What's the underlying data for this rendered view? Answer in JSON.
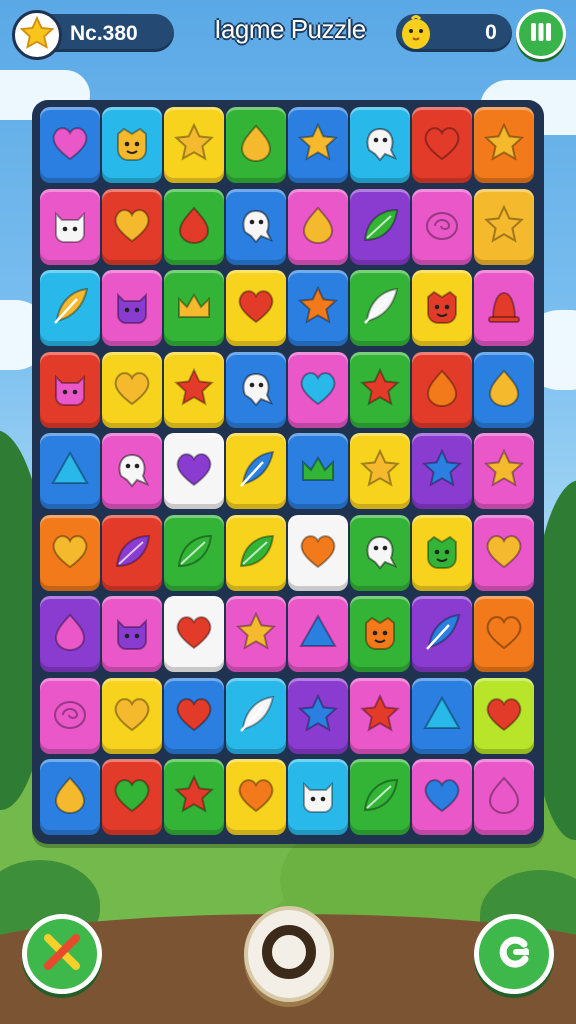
{
  "header": {
    "level_label": "Nc.380",
    "title": "Iagme Puzzle",
    "score": "0",
    "icons": {
      "level": "star-icon",
      "mascot": "chick-icon",
      "menu": "pause-bars-icon"
    }
  },
  "colors": {
    "blue": "#2a7fe0",
    "cyan": "#29b8ea",
    "yellow": "#f7d31e",
    "green": "#33b437",
    "red": "#e33b2a",
    "orange": "#f27a1a",
    "magenta": "#e957c9",
    "purple": "#8a3bd0",
    "white": "#f6f6f6",
    "gold": "#f5b92e",
    "lime": "#b8e52a"
  },
  "board": {
    "rows": [
      [
        [
          "blue",
          "heart",
          "magenta"
        ],
        [
          "cyan",
          "face",
          "gold"
        ],
        [
          "yellow",
          "star",
          "gold"
        ],
        [
          "green",
          "drop",
          "gold"
        ],
        [
          "blue",
          "star",
          "gold"
        ],
        [
          "cyan",
          "ghost",
          "white"
        ],
        [
          "red",
          "heart",
          "red"
        ],
        [
          "orange",
          "star",
          "gold"
        ]
      ],
      [
        [
          "magenta",
          "cat",
          "white"
        ],
        [
          "red",
          "heart",
          "gold"
        ],
        [
          "green",
          "drop",
          "red"
        ],
        [
          "blue",
          "ghost",
          "white"
        ],
        [
          "magenta",
          "drop",
          "gold"
        ],
        [
          "purple",
          "leaf",
          "green"
        ],
        [
          "magenta",
          "swirl",
          "magenta"
        ],
        [
          "gold",
          "star",
          "gold"
        ]
      ],
      [
        [
          "cyan",
          "feather",
          "gold"
        ],
        [
          "magenta",
          "cat",
          "purple"
        ],
        [
          "green",
          "crown",
          "gold"
        ],
        [
          "yellow",
          "heart",
          "red"
        ],
        [
          "blue",
          "star",
          "orange"
        ],
        [
          "green",
          "feather",
          "white"
        ],
        [
          "yellow",
          "face",
          "red"
        ],
        [
          "magenta",
          "bell",
          "red"
        ]
      ],
      [
        [
          "red",
          "cat",
          "magenta"
        ],
        [
          "yellow",
          "heart",
          "gold"
        ],
        [
          "yellow",
          "star",
          "red"
        ],
        [
          "blue",
          "ghost",
          "white"
        ],
        [
          "magenta",
          "heart",
          "cyan"
        ],
        [
          "green",
          "star",
          "red"
        ],
        [
          "red",
          "drop",
          "orange"
        ],
        [
          "blue",
          "drop",
          "gold"
        ]
      ],
      [
        [
          "blue",
          "triangle",
          "cyan"
        ],
        [
          "magenta",
          "ghost",
          "white"
        ],
        [
          "white",
          "heart",
          "purple"
        ],
        [
          "yellow",
          "feather",
          "blue"
        ],
        [
          "blue",
          "crown",
          "green"
        ],
        [
          "yellow",
          "star",
          "gold"
        ],
        [
          "purple",
          "star",
          "blue"
        ],
        [
          "magenta",
          "star",
          "gold"
        ]
      ],
      [
        [
          "orange",
          "heart",
          "gold"
        ],
        [
          "red",
          "leaf",
          "purple"
        ],
        [
          "green",
          "leaf",
          "green"
        ],
        [
          "yellow",
          "leaf",
          "green"
        ],
        [
          "white",
          "heart",
          "orange"
        ],
        [
          "green",
          "ghost",
          "white"
        ],
        [
          "yellow",
          "face",
          "green"
        ],
        [
          "magenta",
          "heart",
          "gold"
        ]
      ],
      [
        [
          "purple",
          "drop",
          "magenta"
        ],
        [
          "magenta",
          "cat",
          "purple"
        ],
        [
          "white",
          "heart",
          "red"
        ],
        [
          "magenta",
          "star",
          "gold"
        ],
        [
          "magenta",
          "triangle",
          "blue"
        ],
        [
          "green",
          "face",
          "orange"
        ],
        [
          "purple",
          "feather",
          "blue"
        ],
        [
          "orange",
          "heart",
          "orange"
        ]
      ],
      [
        [
          "magenta",
          "swirl",
          "magenta"
        ],
        [
          "yellow",
          "heart",
          "gold"
        ],
        [
          "blue",
          "heart",
          "red"
        ],
        [
          "cyan",
          "feather",
          "white"
        ],
        [
          "purple",
          "star",
          "blue"
        ],
        [
          "magenta",
          "star",
          "red"
        ],
        [
          "blue",
          "triangle",
          "cyan"
        ],
        [
          "lime",
          "heart",
          "red"
        ]
      ],
      [
        [
          "blue",
          "drop",
          "gold"
        ],
        [
          "red",
          "heart",
          "green"
        ],
        [
          "green",
          "star",
          "red"
        ],
        [
          "yellow",
          "heart",
          "orange"
        ],
        [
          "cyan",
          "cat",
          "white"
        ],
        [
          "green",
          "leaf",
          "green"
        ],
        [
          "magenta",
          "heart",
          "blue"
        ],
        [
          "magenta",
          "drop",
          "magenta"
        ]
      ]
    ]
  },
  "footer": {
    "left_icon": "shuffle-x-icon",
    "center_icon": "ring-icon",
    "right_icon": "refresh-icon"
  }
}
